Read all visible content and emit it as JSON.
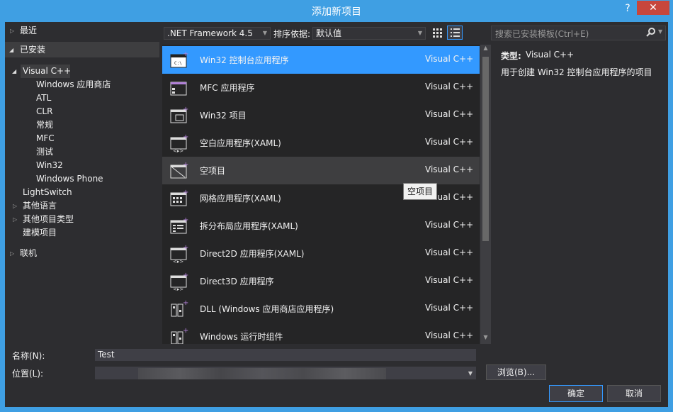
{
  "window": {
    "title": "添加新项目",
    "help_label": "?",
    "close_label": "✕"
  },
  "tree": {
    "recent": "最近",
    "installed": "已安装",
    "visual_cpp": "Visual C++",
    "children": [
      "Windows 应用商店",
      "ATL",
      "CLR",
      "常规",
      "MFC",
      "测试",
      "Win32",
      "Windows Phone"
    ],
    "lightswitch": "LightSwitch",
    "other_languages": "其他语言",
    "other_project_types": "其他项目类型",
    "modeling_projects": "建模项目",
    "online": "联机"
  },
  "toolbar": {
    "framework": ".NET Framework 4.5",
    "sort_label": "排序依据:",
    "sort_value": "默认值"
  },
  "search": {
    "placeholder": "搜索已安装模板(Ctrl+E)"
  },
  "templates": [
    {
      "name": "Win32 控制台应用程序",
      "lang": "Visual C++"
    },
    {
      "name": "MFC 应用程序",
      "lang": "Visual C++"
    },
    {
      "name": "Win32 项目",
      "lang": "Visual C++"
    },
    {
      "name": "空白应用程序(XAML)",
      "lang": "Visual C++"
    },
    {
      "name": "空项目",
      "lang": "Visual C++"
    },
    {
      "name": "网格应用程序(XAML)",
      "lang": "Visual C++"
    },
    {
      "name": "拆分布局应用程序(XAML)",
      "lang": "Visual C++"
    },
    {
      "name": "Direct2D 应用程序(XAML)",
      "lang": "Visual C++"
    },
    {
      "name": "Direct3D 应用程序",
      "lang": "Visual C++"
    },
    {
      "name": "DLL (Windows 应用商店应用程序)",
      "lang": "Visual C++"
    },
    {
      "name": "Windows 运行时组件",
      "lang": "Visual C++"
    }
  ],
  "tooltip": "空项目",
  "detail": {
    "type_label": "类型:",
    "type_value": "Visual C++",
    "description": "用于创建 Win32 控制台应用程序的项目"
  },
  "form": {
    "name_label": "名称(N):",
    "name_value": "Test",
    "location_label": "位置(L):",
    "browse_label": "浏览(B)...",
    "ok_label": "确定",
    "cancel_label": "取消"
  },
  "colors": {
    "selection": "#3399ff",
    "background": "#2d2d30",
    "list_bg": "#252526",
    "title_bar": "#3f9fe3",
    "close_button": "#c7463c",
    "icon_accent": "#b180d7"
  }
}
